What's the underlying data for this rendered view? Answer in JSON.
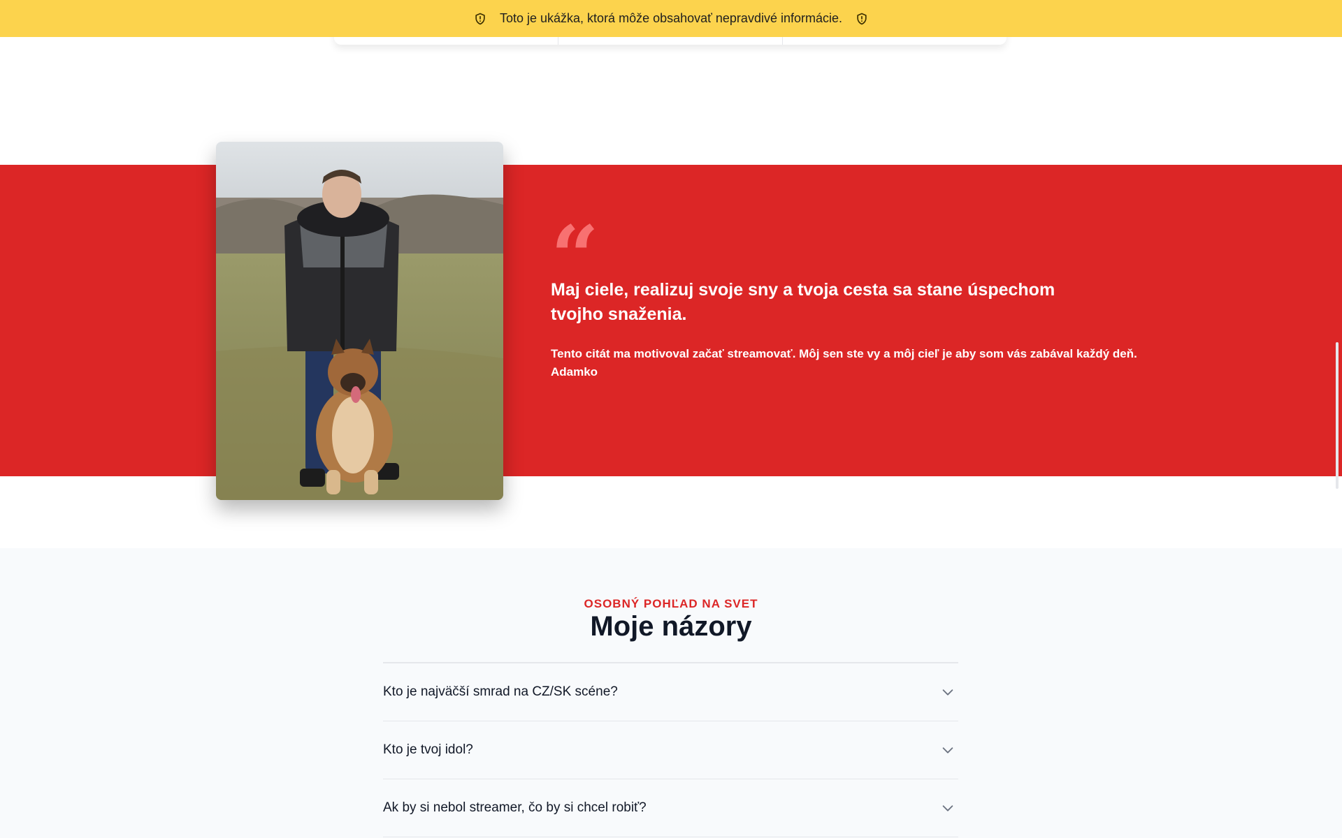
{
  "banner": {
    "text": "Toto je ukážka, ktorá môže obsahovať nepravdivé informácie.",
    "left_icon": "shield-alert-icon",
    "right_icon": "shield-alert-icon",
    "color": "#fcd34d"
  },
  "quote_section": {
    "background_color": "#dc2626",
    "photo_alt": "Adamko s psom na lúke",
    "quote_mark": "“",
    "quote": "Maj ciele, realizuj svoje sny a tvoja cesta sa stane úspechom tvojho snaženia.",
    "description": "Tento citát ma motivoval začať streamovať. Môj sen ste vy a môj cieľ je aby som vás zabával každý deň.",
    "author": "Adamko"
  },
  "opinions": {
    "eyebrow": "OSOBNÝ POHĽAD NA SVET",
    "title": "Moje názory",
    "accent_color": "#dc2626",
    "items": [
      {
        "question": "Kto je najväčší smrad na CZ/SK scéne?",
        "icon": "chevron-down-icon"
      },
      {
        "question": "Kto je tvoj idol?",
        "icon": "chevron-down-icon"
      },
      {
        "question": "Ak by si nebol streamer, čo by si chcel robiť?",
        "icon": "chevron-down-icon"
      }
    ]
  }
}
